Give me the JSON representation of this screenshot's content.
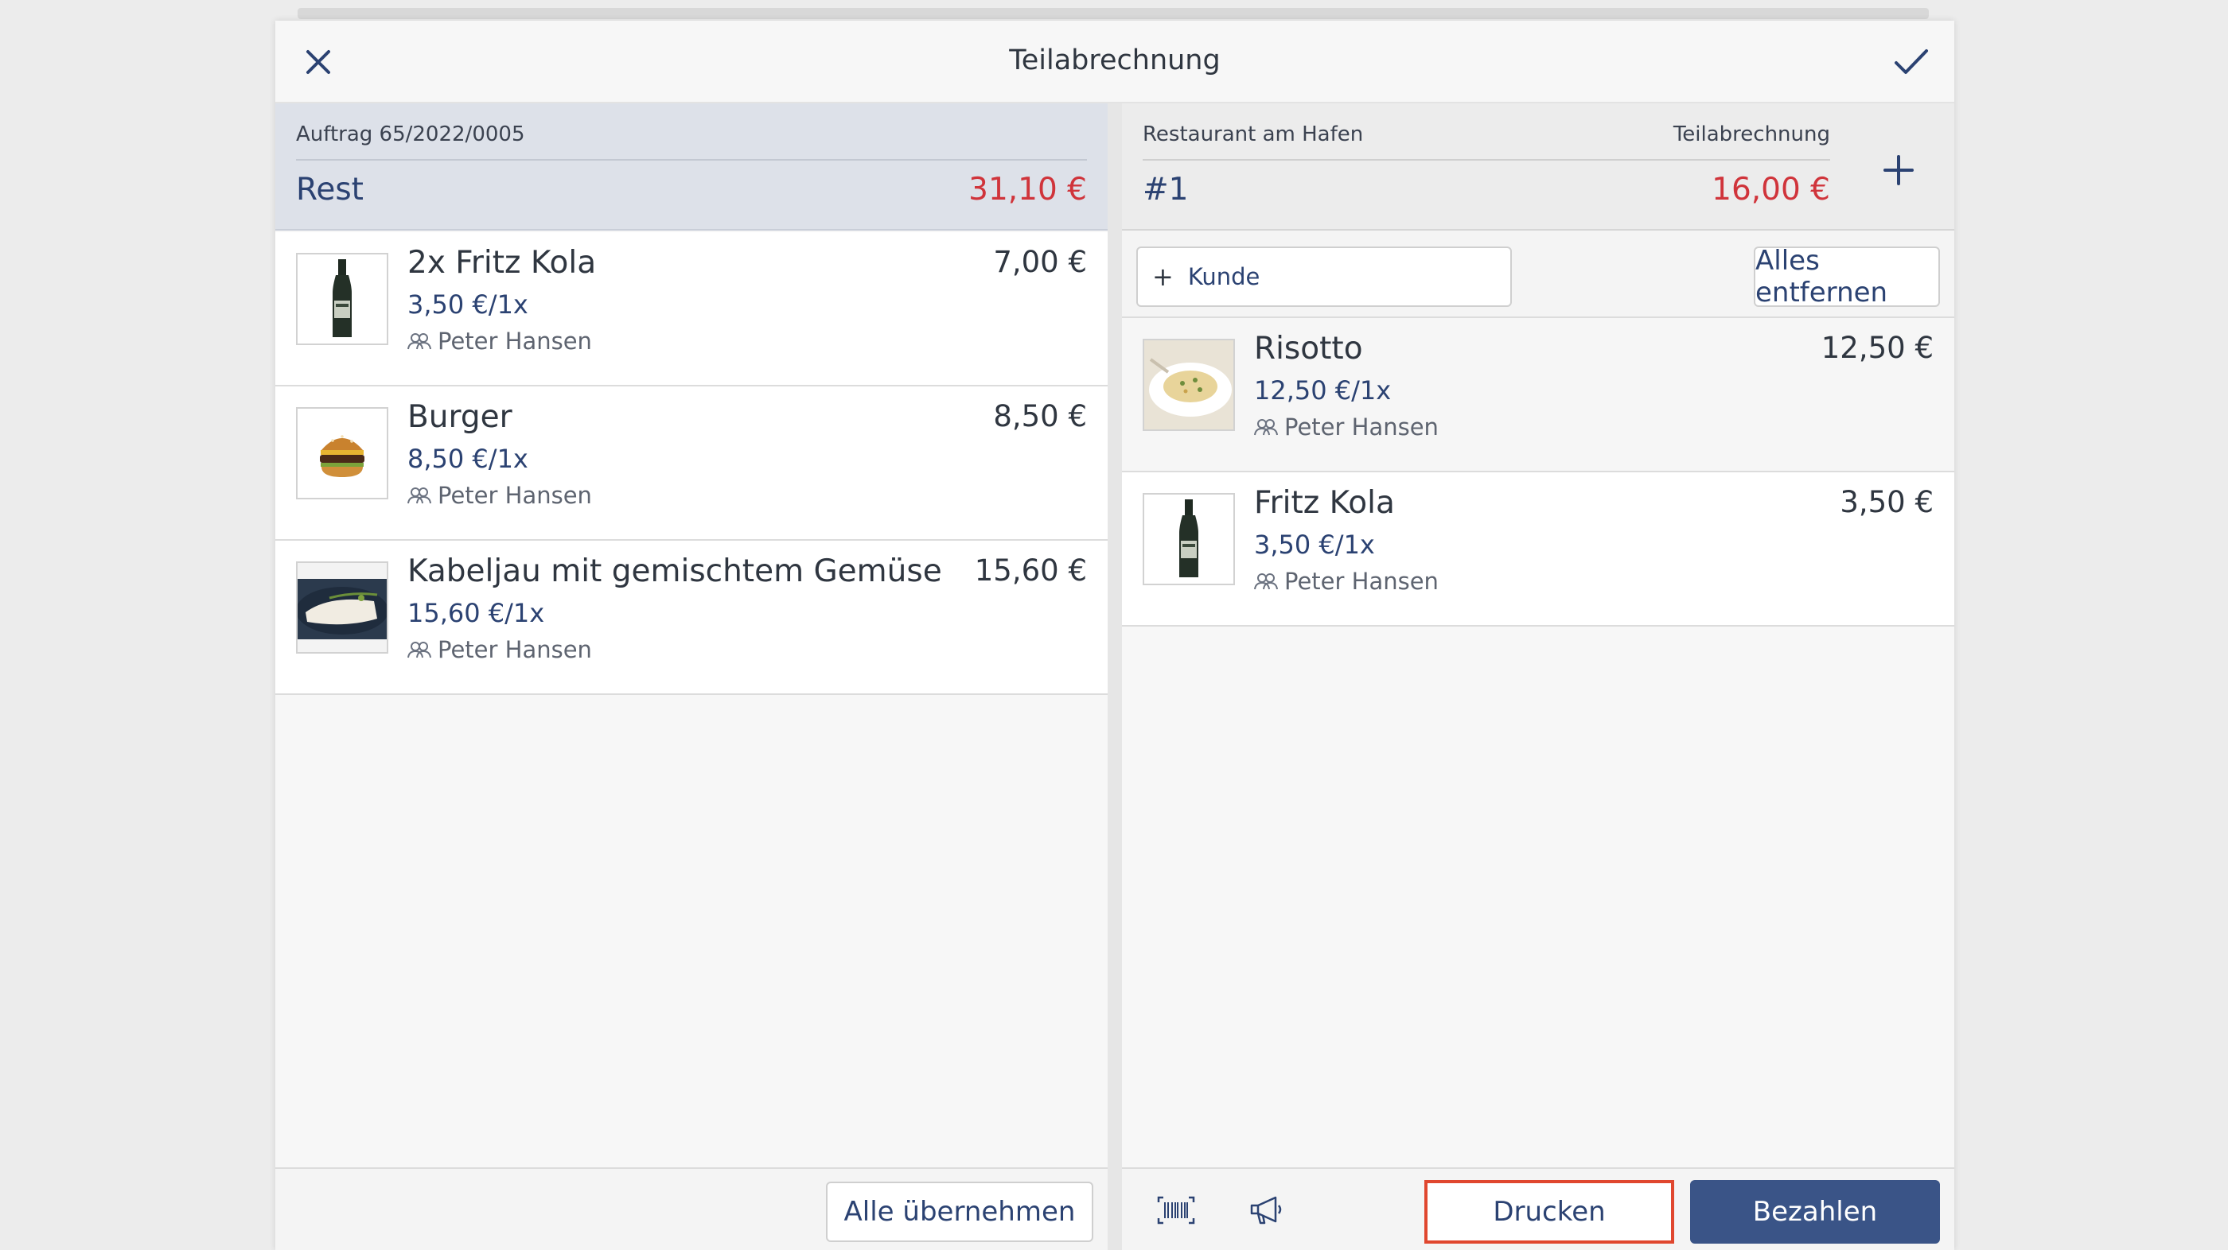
{
  "dialog": {
    "title": "Teilabrechnung"
  },
  "left": {
    "order_ref": "Auftrag 65/2022/0005",
    "summary_label": "Rest",
    "summary_amount": "31,10 €",
    "items": [
      {
        "name": "2x Fritz Kola",
        "unit_price": "3,50 €/1x",
        "guest": "Peter Hansen",
        "price": "7,00 €",
        "thumb": "bottle-image"
      },
      {
        "name": "Burger",
        "unit_price": "8,50 €/1x",
        "guest": "Peter Hansen",
        "price": "8,50 €",
        "thumb": "burger-image"
      },
      {
        "name": "Kabeljau mit gemischtem Gemüse",
        "unit_price": "15,60 €/1x",
        "guest": "Peter Hansen",
        "price": "15,60 €",
        "thumb": "fish-dish-image"
      }
    ],
    "take_all_label": "Alle übernehmen"
  },
  "right": {
    "restaurant": "Restaurant am Hafen",
    "bill_type": "Teilabrechnung",
    "bill_no": "#1",
    "bill_amount": "16,00 €",
    "customer_label": "Kunde",
    "remove_all_label": "Alles entfernen",
    "items": [
      {
        "name": "Risotto",
        "unit_price": "12,50 €/1x",
        "guest": "Peter Hansen",
        "price": "12,50 €",
        "thumb": "risotto-image"
      },
      {
        "name": "Fritz Kola",
        "unit_price": "3,50 €/1x",
        "guest": "Peter Hansen",
        "price": "3,50 €",
        "thumb": "bottle-image"
      }
    ],
    "print_label": "Drucken",
    "pay_label": "Bezahlen"
  },
  "colors": {
    "accent": "#3a5487",
    "amount_red": "#d0343b",
    "highlight_border": "#e0472f"
  },
  "icons": [
    "close-icon",
    "check-icon",
    "plus-icon",
    "barcode-icon",
    "megaphone-icon",
    "guests-icon"
  ]
}
